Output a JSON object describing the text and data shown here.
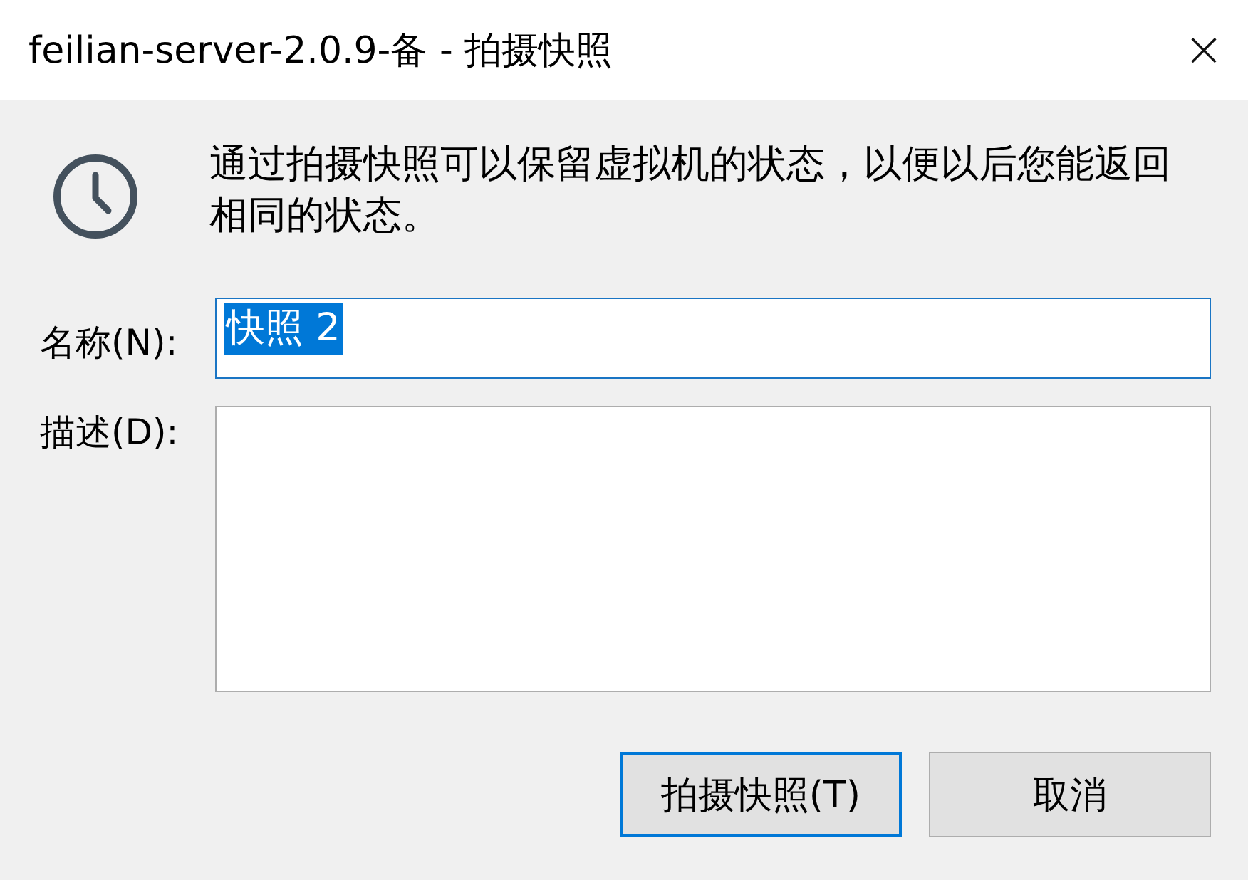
{
  "window": {
    "title": "feilian-server-2.0.9-备 - 拍摄快照",
    "close": "×"
  },
  "message": "通过拍摄快照可以保留虚拟机的状态，以便以后您能返回相同的状态。",
  "name_field": {
    "label": "名称(N):",
    "value": "快照 2",
    "selected": true,
    "focused": true
  },
  "description_field": {
    "label": "描述(D):",
    "focused": false
  },
  "buttons": [
    {
      "label": "拍摄快照(T)",
      "default": true
    },
    {
      "label": "取消",
      "default": false
    }
  ]
}
